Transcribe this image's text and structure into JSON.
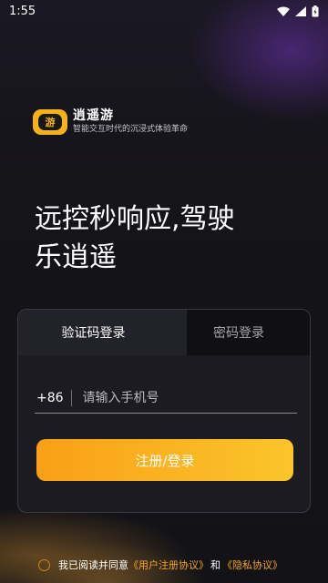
{
  "status_bar": {
    "time": "1:55",
    "icons": [
      "wifi-icon",
      "signal-icon",
      "battery-icon"
    ]
  },
  "brand": {
    "logo_glyph": "游",
    "name": "逍遥游",
    "slogan": "智能交互时代的沉浸式体验革命"
  },
  "headline": {
    "line1": "远控秒响应,驾驶",
    "line2": "乐逍遥"
  },
  "login": {
    "tabs": [
      {
        "label": "验证码登录",
        "active": true
      },
      {
        "label": "密码登录",
        "active": false
      }
    ],
    "country_code": "+86",
    "phone_placeholder": "请输入手机号",
    "phone_value": "",
    "submit_label": "注册/登录"
  },
  "agreement": {
    "prefix": "我已阅读并同意",
    "user_agreement": "《用户注册协议》",
    "and": "和",
    "privacy": "《隐私协议》"
  },
  "colors": {
    "accent": "#f9a016",
    "accent_end": "#fbc52b",
    "link": "#f5a623",
    "background": "#141419"
  }
}
